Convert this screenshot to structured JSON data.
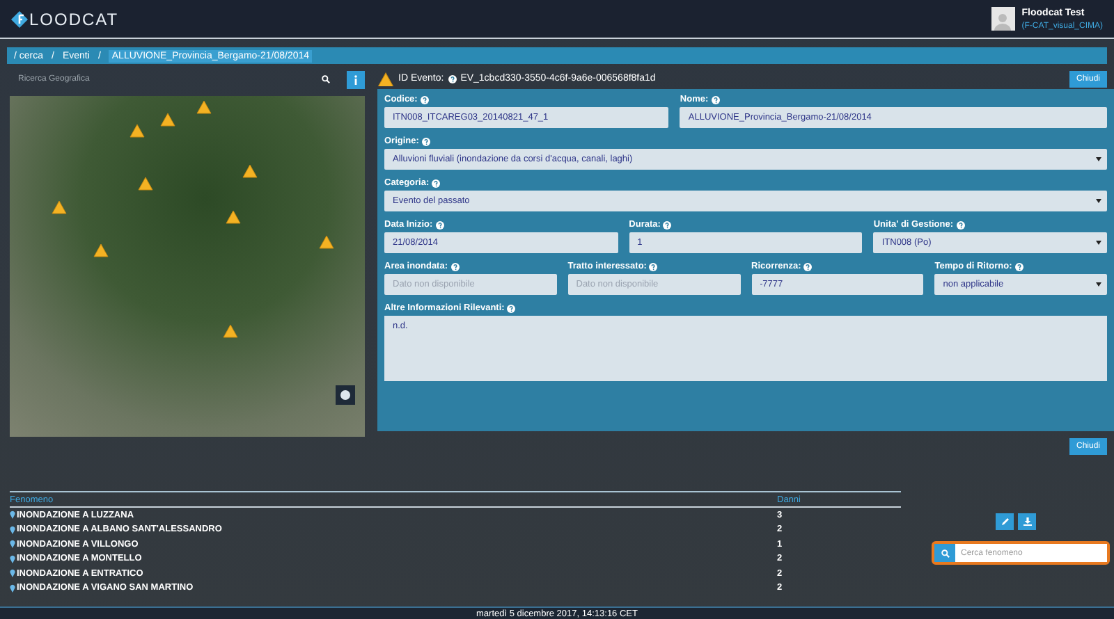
{
  "header": {
    "logo": "LOODCAT",
    "user": {
      "name": "Floodcat Test",
      "role": "(F-CAT_visual_CIMA)"
    }
  },
  "breadcrumb": {
    "separator": "/",
    "items": [
      "/ cerca",
      "Eventi",
      "ALLUVIONE_Provincia_Bergamo-21/08/2014"
    ]
  },
  "map_panel": {
    "search": {
      "placeholder": "Ricerca Geografica"
    }
  },
  "event": {
    "id_label": "ID Evento:",
    "id_value": "EV_1cbcd330-3550-4c6f-9a6e-006568f8fa1d",
    "close_top": "Chiudi",
    "close_bottom": "Chiudi"
  },
  "form_rows": [
    [
      {
        "kind": "input",
        "label": "Codice:",
        "value": "ITN008_ITCAREG03_20140821_47_1"
      },
      {
        "kind": "input",
        "label": "Nome:",
        "value": "ALLUVIONE_Provincia_Bergamo-21/08/2014",
        "wide": true
      }
    ],
    [
      {
        "kind": "select",
        "label": "Origine:",
        "value": "Alluvioni fluviali (inondazione da corsi d'acqua, canali, laghi)"
      }
    ],
    [
      {
        "kind": "select",
        "label": "Categoria:",
        "value": "Evento del passato"
      }
    ],
    [
      {
        "kind": "input",
        "label": "Data Inizio:",
        "value": "21/08/2014"
      },
      {
        "kind": "input",
        "label": "Durata:",
        "value": "1"
      },
      {
        "kind": "select",
        "label": "Unita' di Gestione:",
        "value": "ITN008 (Po)"
      }
    ],
    [
      {
        "kind": "input",
        "label": "Area inondata:",
        "placeholder": "Dato non disponibile"
      },
      {
        "kind": "input",
        "label": "Tratto interessato:",
        "placeholder": "Dato non disponibile"
      },
      {
        "kind": "input",
        "label": "Ricorrenza:",
        "value": "-7777"
      },
      {
        "kind": "select",
        "label": "Tempo di Ritorno:",
        "value": "non applicabile"
      }
    ],
    [
      {
        "kind": "textarea",
        "label": "Altre Informazioni Rilevanti:",
        "value": "n.d."
      }
    ]
  ],
  "table": {
    "columns": [
      "Fenomeno",
      "Danni"
    ],
    "rows": [
      {
        "name": "INONDAZIONE A LUZZANA",
        "danni": "3"
      },
      {
        "name": "INONDAZIONE A ALBANO SANT'ALESSANDRO",
        "danni": "2"
      },
      {
        "name": "INONDAZIONE A VILLONGO",
        "danni": "1"
      },
      {
        "name": "INONDAZIONE A MONTELLO",
        "danni": "2"
      },
      {
        "name": "INONDAZIONE A ENTRATICO",
        "danni": "2"
      },
      {
        "name": "INONDAZIONE A VIGANO SAN MARTINO",
        "danni": "2"
      }
    ]
  },
  "phenomenon_search": {
    "placeholder": "Cerca fenomeno"
  },
  "status_bar": "martedì 5 dicembre 2017, 14:13:16 CET"
}
